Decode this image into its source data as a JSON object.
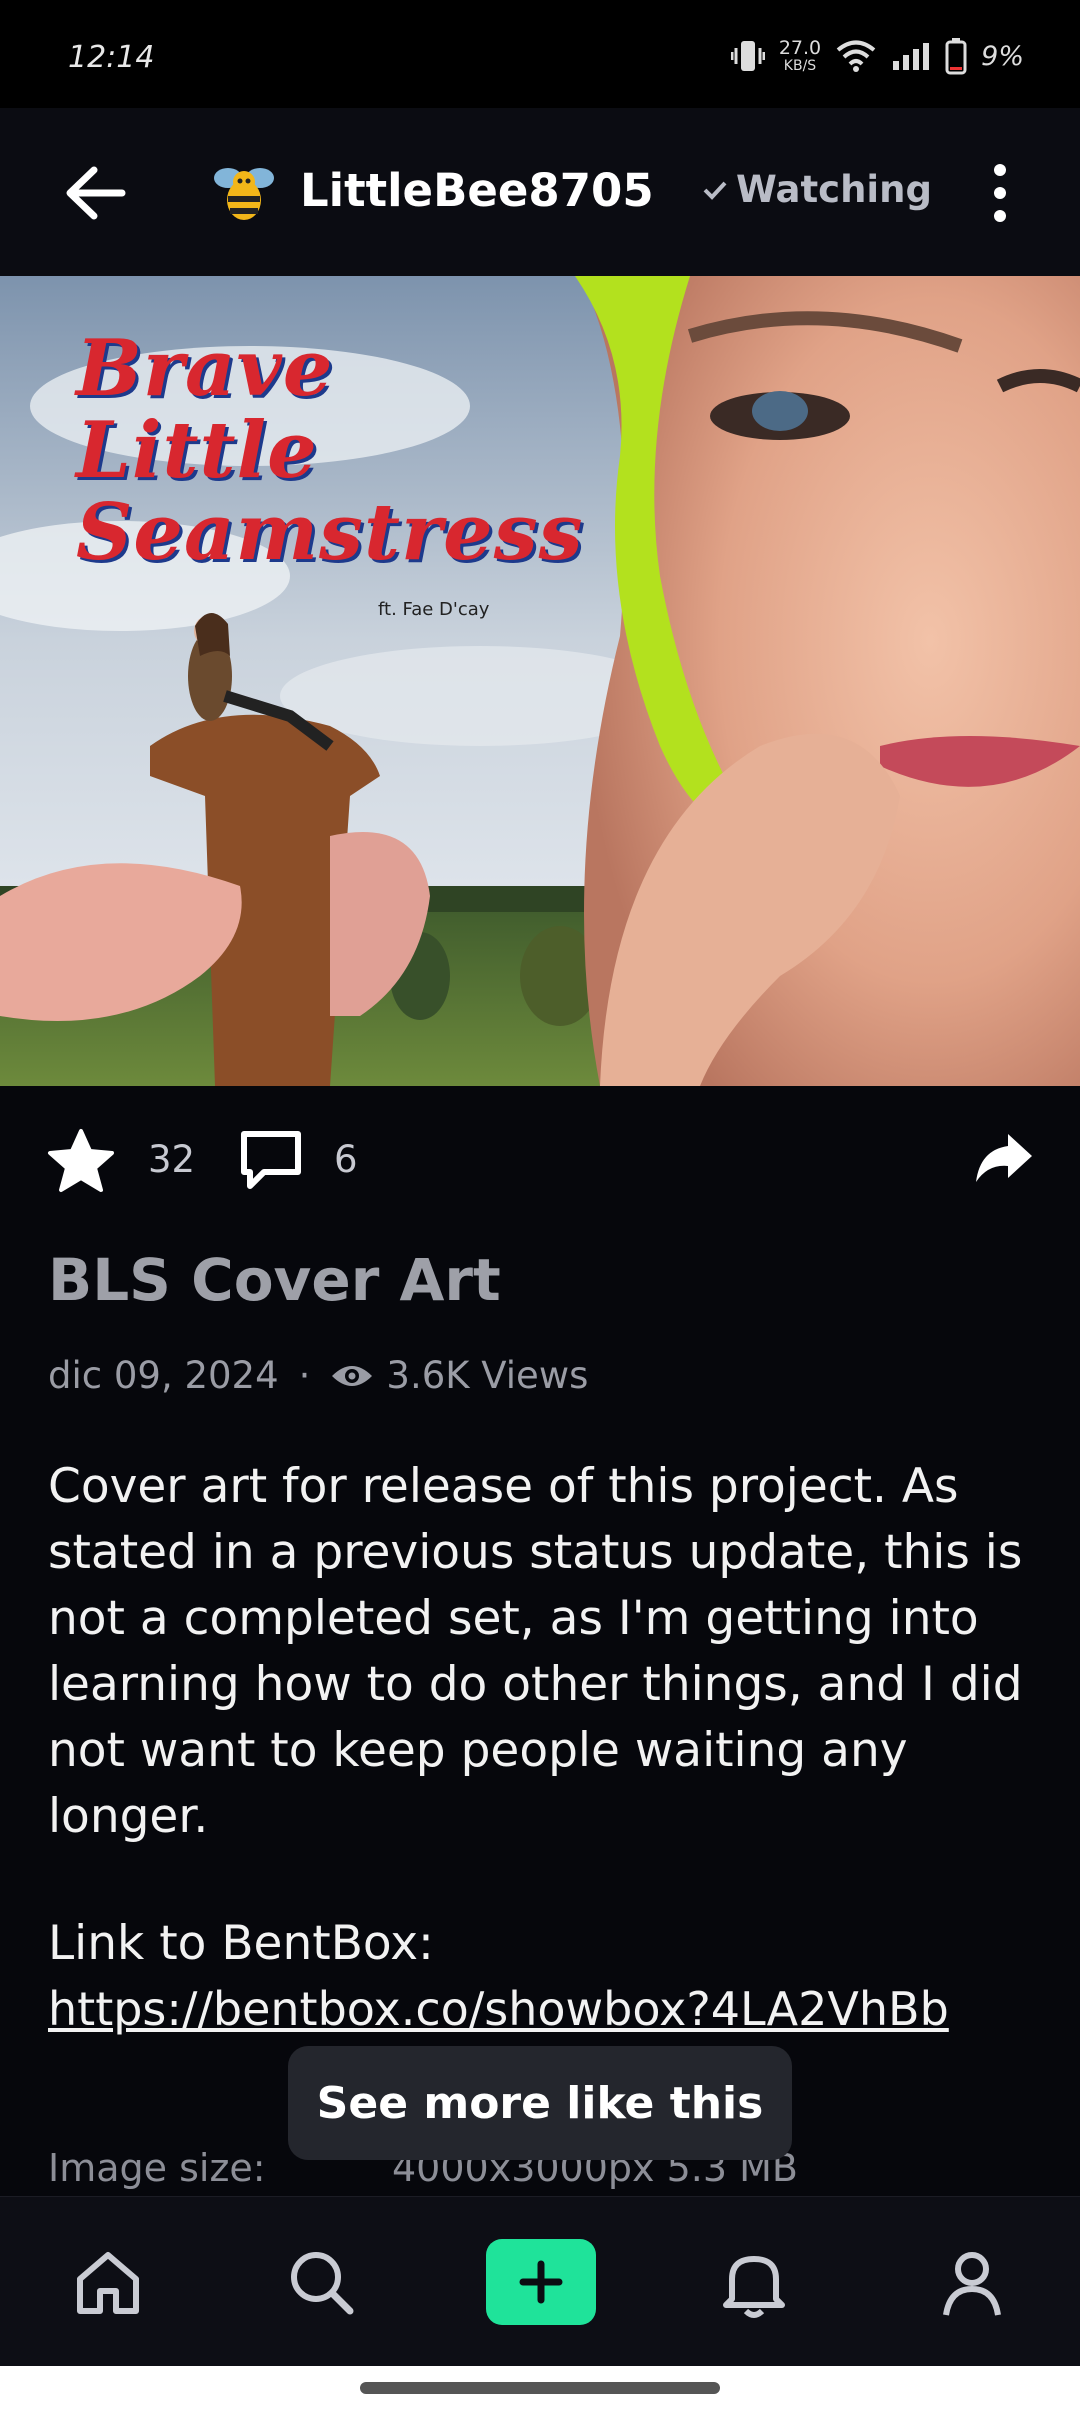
{
  "status_bar": {
    "time": "12:14",
    "speed_value": "27.0",
    "speed_unit": "KB/S",
    "battery": "9%"
  },
  "header": {
    "username": "LittleBee8705",
    "watch_label": "Watching",
    "icons": [
      "back-arrow-icon",
      "bee-avatar",
      "check-icon",
      "more-vert-icon"
    ]
  },
  "artwork": {
    "title_lines": [
      "Brave",
      "Little",
      "Seamstress"
    ],
    "credit": "ft. Fae D'cay"
  },
  "stats": {
    "favorites": "32",
    "comments": "6"
  },
  "post": {
    "title": "BLS Cover Art",
    "date": "dic 09, 2024",
    "separator": "·",
    "views": "3.6K Views",
    "description": "Cover art for release of this project. As stated in a previous status update, this is not a completed set, as I'm getting into learning how to do other things, and I did not want to keep people waiting any longer.",
    "link_label": "Link to BentBox:",
    "link": "https://bentbox.co/showbox?4LA2VhBb"
  },
  "details": {
    "image_size_label": "Image size:",
    "image_size_value": "4000x3000px 5.3 MB"
  },
  "toast": {
    "label": "See more like this"
  },
  "bottom_nav": {
    "items": [
      "home-icon",
      "search-icon",
      "add-icon",
      "bell-icon",
      "profile-icon"
    ],
    "accent_color": "#1fe39a"
  }
}
